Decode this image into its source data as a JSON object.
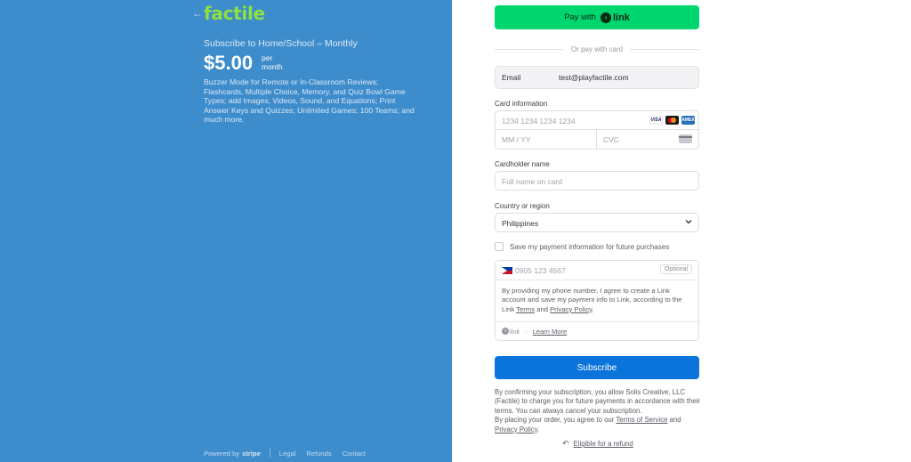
{
  "left": {
    "back_arrow": "←",
    "logo": "factile",
    "plan_name": "Subscribe to Home/School – Monthly",
    "price": "$5.00",
    "price_per": "per",
    "price_period": "month",
    "description": "Buzzer Mode for Remote or In-Classroom Reviews; Flashcards, Multiple Choice, Memory, and Quiz Bowl Game Types; add Images, Videos, Sound, and Equations; Print Answer Keys and Quizzes; Unlimited Games; 100 Teams; and much more.",
    "footer": {
      "powered_by": "Powered by",
      "stripe": "stripe",
      "legal": "Legal",
      "refunds": "Refunds",
      "contact": "Contact"
    }
  },
  "right": {
    "pay_with_link": {
      "label": "Pay with",
      "brand": "link"
    },
    "divider_text": "Or pay with card",
    "email": {
      "label": "Email",
      "value": "test@playfactile.com"
    },
    "card_information_label": "Card information",
    "card_number_placeholder": "1234 1234 1234 1234",
    "card_brands": [
      "VISA",
      "mastercard",
      "AMEX"
    ],
    "expiry_placeholder": "MM / YY",
    "cvc_placeholder": "CVC",
    "cardholder_label": "Cardholder name",
    "cardholder_placeholder": "Full name on card",
    "country_label": "Country or region",
    "country_value": "Philippines",
    "save_info_label": "Save my payment information for future purchases",
    "phone_placeholder": "0905 123 4567",
    "phone_optional": "Optional",
    "consent": {
      "text_1": "By providing my phone number, I agree to create a Link account and save my payment info to Link, according to the Link ",
      "terms": "Terms",
      "and": " and ",
      "privacy": "Privacy Policy",
      "period": "."
    },
    "link_footer": {
      "brand": "link",
      "dot": "·",
      "learn_more": "Learn More"
    },
    "subscribe_label": "Subscribe",
    "legal": {
      "text_1": "By confirming your subscription, you allow Solis Creative, LLC (Factile) to charge you for future payments in accordance with their terms. You can always cancel your subscription.",
      "text_2": "By placing your order, you agree to our ",
      "tos": "Terms of Service",
      "and": " and",
      "privacy": "Privacy Policy",
      "period": "."
    },
    "refund": {
      "icon": "↶",
      "label": "Eligible for a refund"
    }
  },
  "colors": {
    "left_panel": "#3d8ccb",
    "logo_green": "#8fe13f",
    "link_button": "#00d66f",
    "subscribe_button": "#0a74da"
  }
}
